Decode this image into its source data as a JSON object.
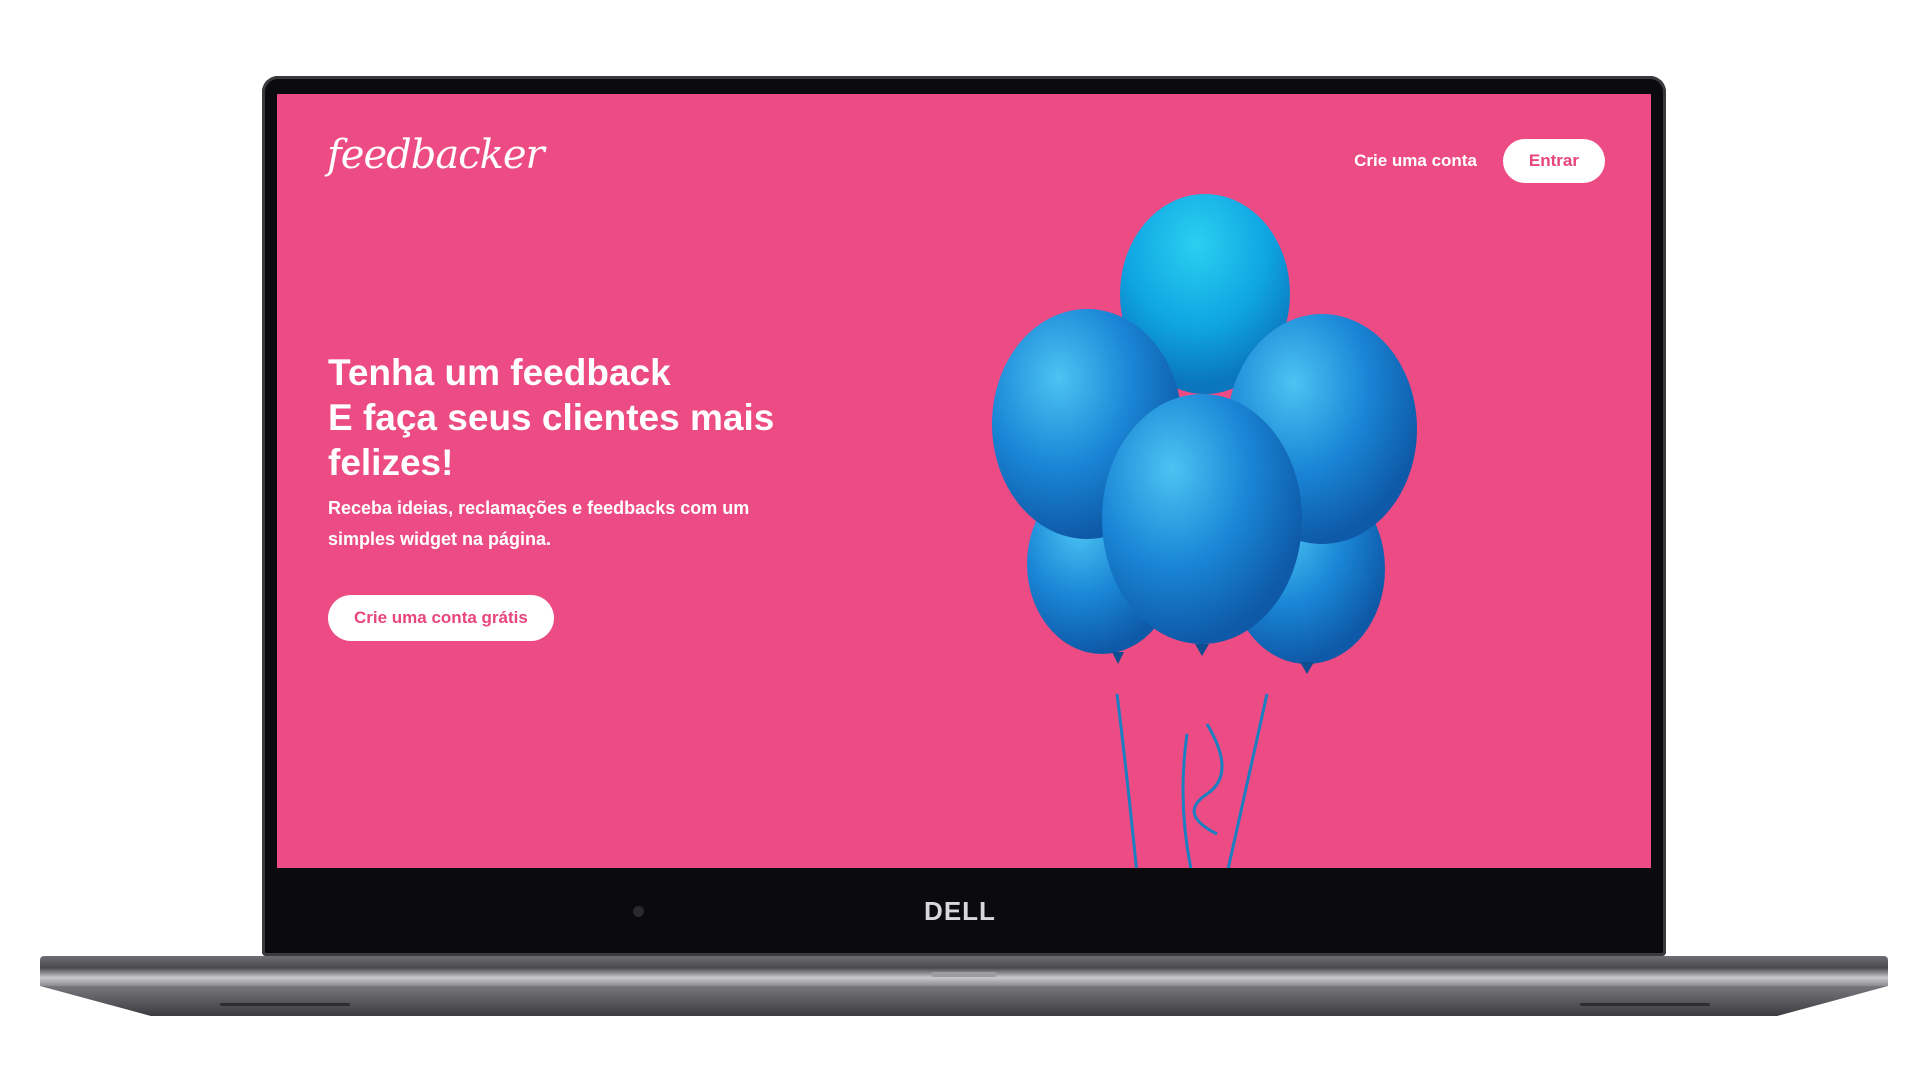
{
  "device": {
    "brand": "DELL"
  },
  "site": {
    "logo_text": "feedbacker",
    "nav": {
      "signup_label": "Crie uma conta",
      "login_label": "Entrar"
    },
    "hero": {
      "title_line1": "Tenha um feedback",
      "title_line2": "E faça seus clientes mais felizes!",
      "subtitle": "Receba ideias, reclamações e feedbacks com um simples widget na página.",
      "cta_label": "Crie uma conta grátis"
    },
    "image": {
      "icon": "balloons-illustration"
    },
    "colors": {
      "background": "#ec4b84",
      "accent_text": "#e8457f",
      "balloon": "#1e88d8"
    }
  }
}
